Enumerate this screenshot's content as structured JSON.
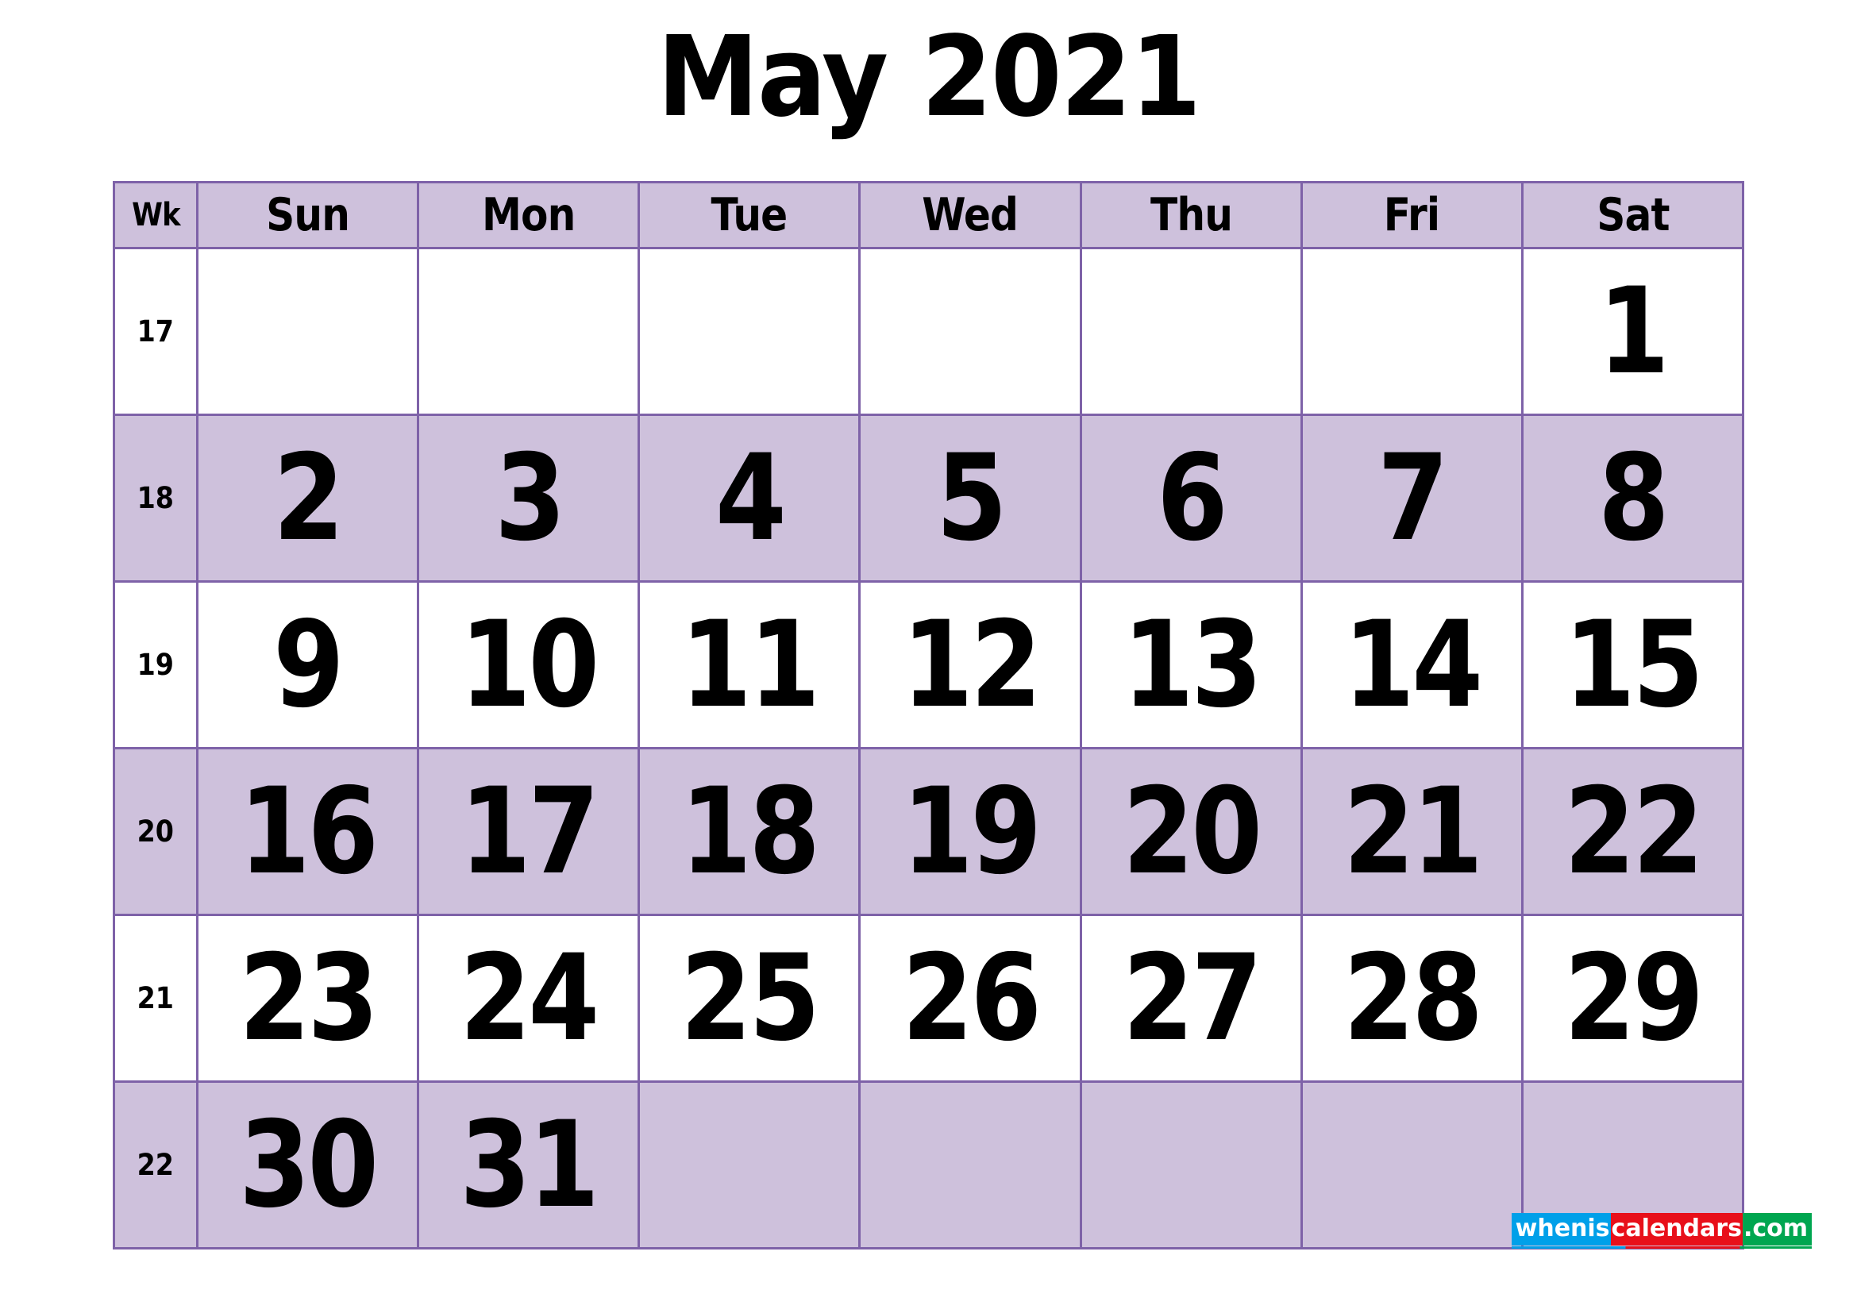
{
  "title": "May 2021",
  "theme": {
    "accent_fill": "#CEC1DC",
    "accent_border": "#7E62A8",
    "text": "#000000",
    "page_bg": "#FFFFFF"
  },
  "header": {
    "week_label": "Wk",
    "days": [
      "Sun",
      "Mon",
      "Tue",
      "Wed",
      "Thu",
      "Fri",
      "Sat"
    ]
  },
  "weeks": [
    {
      "wk": "17",
      "shaded": false,
      "days": [
        "",
        "",
        "",
        "",
        "",
        "",
        "1"
      ]
    },
    {
      "wk": "18",
      "shaded": true,
      "days": [
        "2",
        "3",
        "4",
        "5",
        "6",
        "7",
        "8"
      ]
    },
    {
      "wk": "19",
      "shaded": false,
      "days": [
        "9",
        "10",
        "11",
        "12",
        "13",
        "14",
        "15"
      ]
    },
    {
      "wk": "20",
      "shaded": true,
      "days": [
        "16",
        "17",
        "18",
        "19",
        "20",
        "21",
        "22"
      ]
    },
    {
      "wk": "21",
      "shaded": false,
      "days": [
        "23",
        "24",
        "25",
        "26",
        "27",
        "28",
        "29"
      ]
    },
    {
      "wk": "22",
      "shaded": true,
      "days": [
        "30",
        "31",
        "",
        "",
        "",
        "",
        ""
      ]
    }
  ],
  "logo": {
    "part1": "whenis",
    "part2": "calendars",
    "part3": ".com",
    "color1": "#00A0E9",
    "color2": "#E8101A",
    "color3": "#00A650"
  }
}
